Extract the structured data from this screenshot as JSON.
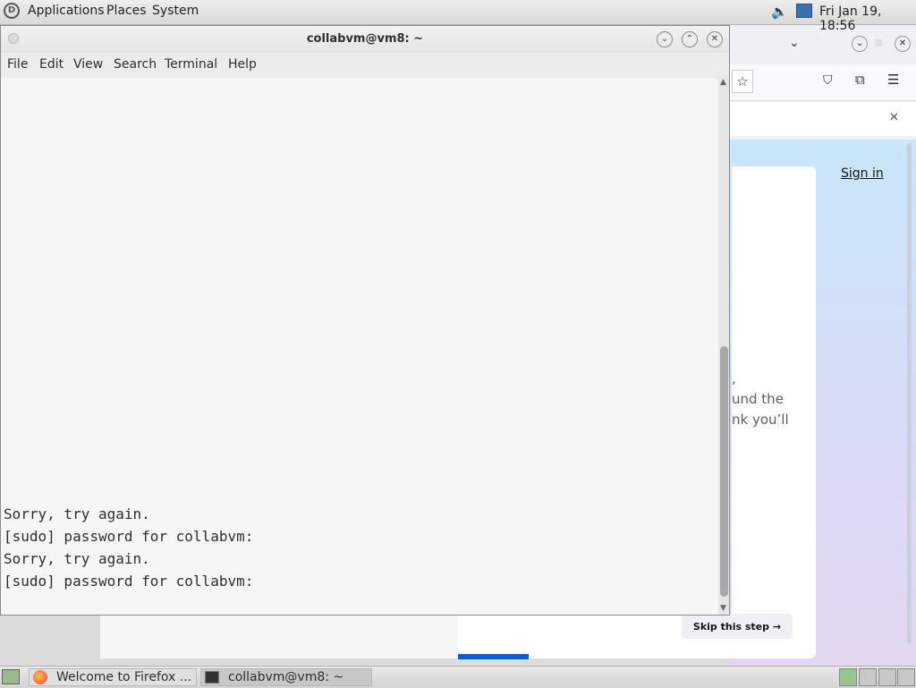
{
  "top_panel": {
    "menus": [
      "Applications",
      "Places",
      "System"
    ],
    "clock": "Fri Jan 19, 18:56"
  },
  "terminal": {
    "title": "collabvm@vm8: ~",
    "menu": [
      "File",
      "Edit",
      "View",
      "Search",
      "Terminal",
      "Help"
    ],
    "lines": [
      "Sorry, try again.",
      "[sudo] password for collabvm:",
      "Sorry, try again.",
      "[sudo] password for collabvm:"
    ]
  },
  "firefox": {
    "sign_in": "Sign in",
    "partial_lines": [
      ",",
      "und the",
      "nk you’ll"
    ],
    "skip_label": "Skip this step →"
  },
  "taskbar": {
    "tasks": [
      "Welcome to Firefox ...",
      "collabvm@vm8: ~"
    ]
  },
  "colors": {
    "accent": "#0060df",
    "terminal_bg": "#f6f6f6"
  }
}
